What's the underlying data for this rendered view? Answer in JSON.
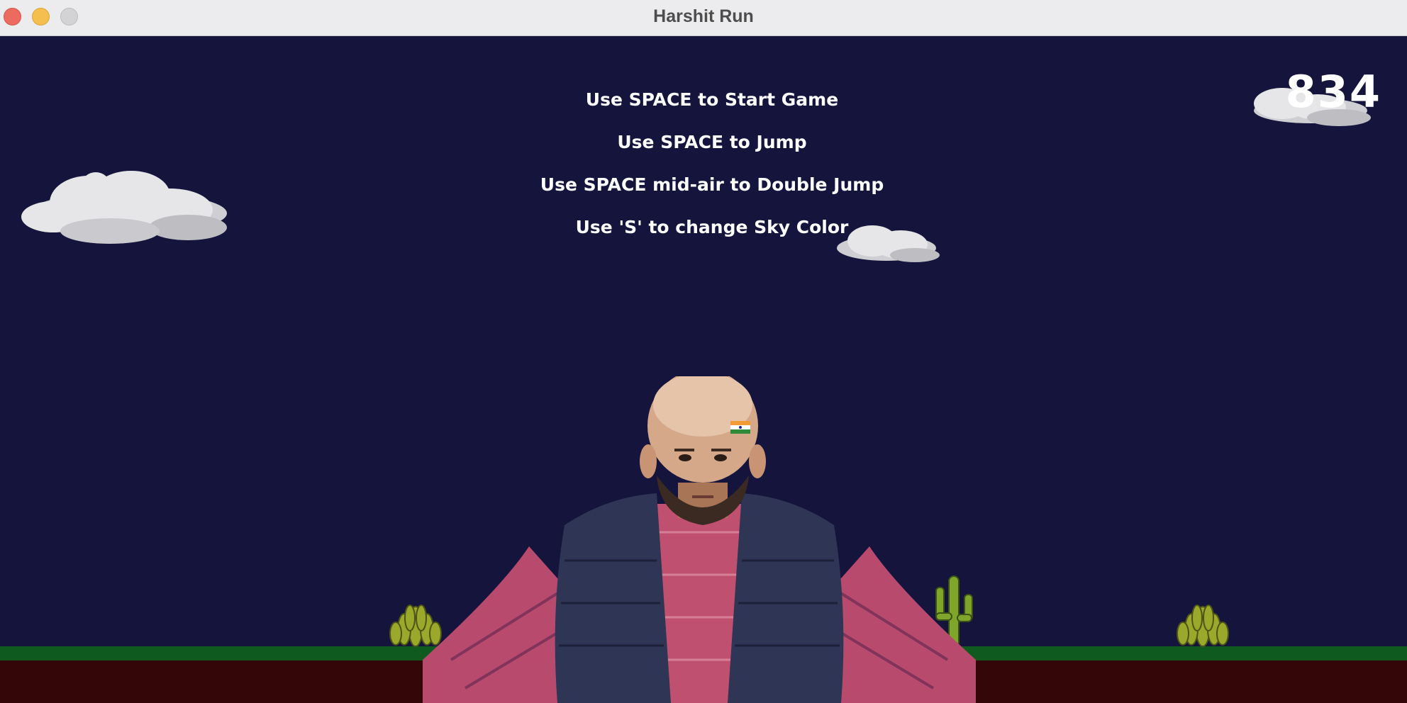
{
  "window": {
    "title": "Harshit Run"
  },
  "game": {
    "instructions": [
      "Use SPACE to Start Game",
      "Use SPACE to Jump",
      "Use SPACE mid-air to Double Jump",
      "Use 'S' to change Sky Color"
    ],
    "score": "834"
  },
  "colors": {
    "sky": "#14143d",
    "grass": "#0f5a1e",
    "dirt": "#350607",
    "text": "#ffffff"
  }
}
